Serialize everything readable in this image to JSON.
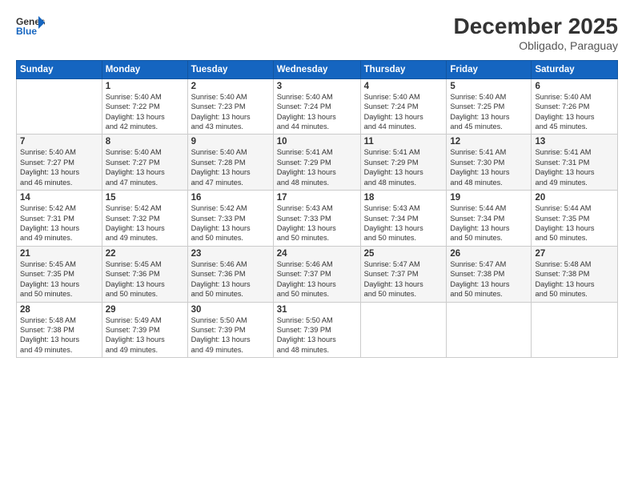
{
  "logo": {
    "line1": "General",
    "line2": "Blue"
  },
  "title": "December 2025",
  "subtitle": "Obligado, Paraguay",
  "days_header": [
    "Sunday",
    "Monday",
    "Tuesday",
    "Wednesday",
    "Thursday",
    "Friday",
    "Saturday"
  ],
  "weeks": [
    [
      {
        "num": "",
        "info": ""
      },
      {
        "num": "1",
        "info": "Sunrise: 5:40 AM\nSunset: 7:22 PM\nDaylight: 13 hours\nand 42 minutes."
      },
      {
        "num": "2",
        "info": "Sunrise: 5:40 AM\nSunset: 7:23 PM\nDaylight: 13 hours\nand 43 minutes."
      },
      {
        "num": "3",
        "info": "Sunrise: 5:40 AM\nSunset: 7:24 PM\nDaylight: 13 hours\nand 44 minutes."
      },
      {
        "num": "4",
        "info": "Sunrise: 5:40 AM\nSunset: 7:24 PM\nDaylight: 13 hours\nand 44 minutes."
      },
      {
        "num": "5",
        "info": "Sunrise: 5:40 AM\nSunset: 7:25 PM\nDaylight: 13 hours\nand 45 minutes."
      },
      {
        "num": "6",
        "info": "Sunrise: 5:40 AM\nSunset: 7:26 PM\nDaylight: 13 hours\nand 45 minutes."
      }
    ],
    [
      {
        "num": "7",
        "info": "Sunrise: 5:40 AM\nSunset: 7:27 PM\nDaylight: 13 hours\nand 46 minutes."
      },
      {
        "num": "8",
        "info": "Sunrise: 5:40 AM\nSunset: 7:27 PM\nDaylight: 13 hours\nand 47 minutes."
      },
      {
        "num": "9",
        "info": "Sunrise: 5:40 AM\nSunset: 7:28 PM\nDaylight: 13 hours\nand 47 minutes."
      },
      {
        "num": "10",
        "info": "Sunrise: 5:41 AM\nSunset: 7:29 PM\nDaylight: 13 hours\nand 48 minutes."
      },
      {
        "num": "11",
        "info": "Sunrise: 5:41 AM\nSunset: 7:29 PM\nDaylight: 13 hours\nand 48 minutes."
      },
      {
        "num": "12",
        "info": "Sunrise: 5:41 AM\nSunset: 7:30 PM\nDaylight: 13 hours\nand 48 minutes."
      },
      {
        "num": "13",
        "info": "Sunrise: 5:41 AM\nSunset: 7:31 PM\nDaylight: 13 hours\nand 49 minutes."
      }
    ],
    [
      {
        "num": "14",
        "info": "Sunrise: 5:42 AM\nSunset: 7:31 PM\nDaylight: 13 hours\nand 49 minutes."
      },
      {
        "num": "15",
        "info": "Sunrise: 5:42 AM\nSunset: 7:32 PM\nDaylight: 13 hours\nand 49 minutes."
      },
      {
        "num": "16",
        "info": "Sunrise: 5:42 AM\nSunset: 7:33 PM\nDaylight: 13 hours\nand 50 minutes."
      },
      {
        "num": "17",
        "info": "Sunrise: 5:43 AM\nSunset: 7:33 PM\nDaylight: 13 hours\nand 50 minutes."
      },
      {
        "num": "18",
        "info": "Sunrise: 5:43 AM\nSunset: 7:34 PM\nDaylight: 13 hours\nand 50 minutes."
      },
      {
        "num": "19",
        "info": "Sunrise: 5:44 AM\nSunset: 7:34 PM\nDaylight: 13 hours\nand 50 minutes."
      },
      {
        "num": "20",
        "info": "Sunrise: 5:44 AM\nSunset: 7:35 PM\nDaylight: 13 hours\nand 50 minutes."
      }
    ],
    [
      {
        "num": "21",
        "info": "Sunrise: 5:45 AM\nSunset: 7:35 PM\nDaylight: 13 hours\nand 50 minutes."
      },
      {
        "num": "22",
        "info": "Sunrise: 5:45 AM\nSunset: 7:36 PM\nDaylight: 13 hours\nand 50 minutes."
      },
      {
        "num": "23",
        "info": "Sunrise: 5:46 AM\nSunset: 7:36 PM\nDaylight: 13 hours\nand 50 minutes."
      },
      {
        "num": "24",
        "info": "Sunrise: 5:46 AM\nSunset: 7:37 PM\nDaylight: 13 hours\nand 50 minutes."
      },
      {
        "num": "25",
        "info": "Sunrise: 5:47 AM\nSunset: 7:37 PM\nDaylight: 13 hours\nand 50 minutes."
      },
      {
        "num": "26",
        "info": "Sunrise: 5:47 AM\nSunset: 7:38 PM\nDaylight: 13 hours\nand 50 minutes."
      },
      {
        "num": "27",
        "info": "Sunrise: 5:48 AM\nSunset: 7:38 PM\nDaylight: 13 hours\nand 50 minutes."
      }
    ],
    [
      {
        "num": "28",
        "info": "Sunrise: 5:48 AM\nSunset: 7:38 PM\nDaylight: 13 hours\nand 49 minutes."
      },
      {
        "num": "29",
        "info": "Sunrise: 5:49 AM\nSunset: 7:39 PM\nDaylight: 13 hours\nand 49 minutes."
      },
      {
        "num": "30",
        "info": "Sunrise: 5:50 AM\nSunset: 7:39 PM\nDaylight: 13 hours\nand 49 minutes."
      },
      {
        "num": "31",
        "info": "Sunrise: 5:50 AM\nSunset: 7:39 PM\nDaylight: 13 hours\nand 48 minutes."
      },
      {
        "num": "",
        "info": ""
      },
      {
        "num": "",
        "info": ""
      },
      {
        "num": "",
        "info": ""
      }
    ]
  ]
}
